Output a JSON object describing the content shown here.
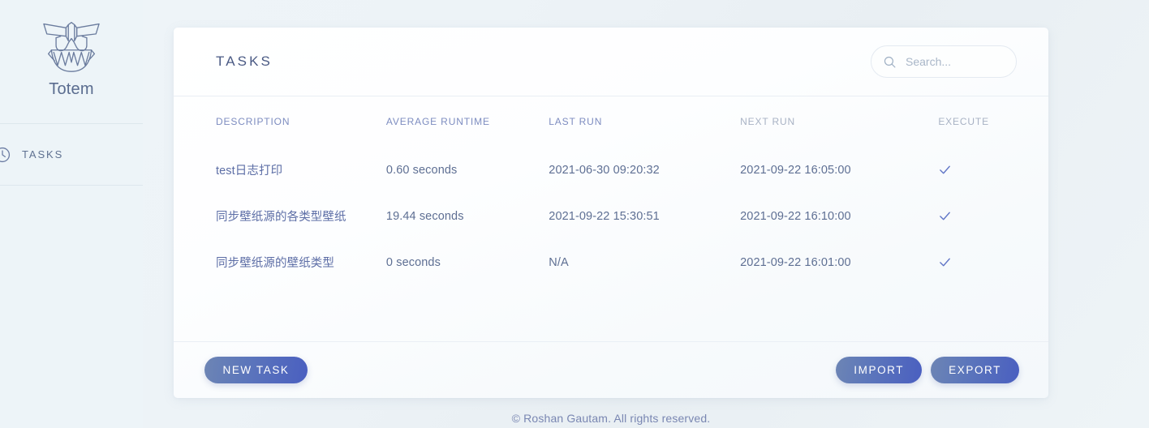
{
  "sidebar": {
    "brand": {
      "name": "Totem",
      "logo_icon": "totem-mask-icon"
    },
    "items": [
      {
        "label": "TASKS",
        "icon": "clock-icon",
        "active": true
      }
    ]
  },
  "header": {
    "title": "TASKS",
    "search": {
      "placeholder": "Search...",
      "value": "",
      "icon": "search-icon"
    }
  },
  "table": {
    "columns": [
      {
        "key": "description",
        "label": "DESCRIPTION",
        "muted": false
      },
      {
        "key": "average_runtime",
        "label": "AVERAGE RUNTIME",
        "muted": false
      },
      {
        "key": "last_run",
        "label": "LAST RUN",
        "muted": false
      },
      {
        "key": "next_run",
        "label": "NEXT RUN",
        "muted": true
      },
      {
        "key": "execute",
        "label": "EXECUTE",
        "muted": true
      }
    ],
    "rows": [
      {
        "description": "test日志打印",
        "average_runtime": "0.60 seconds",
        "last_run": "2021-06-30 09:20:32",
        "next_run": "2021-09-22 16:05:00",
        "execute_icon": "check-icon",
        "error": false
      },
      {
        "description": "同步壁纸源的各类型壁纸",
        "average_runtime": "19.44 seconds",
        "last_run": "2021-09-22 15:30:51",
        "next_run": "2021-09-22 16:10:00",
        "execute_icon": "check-icon",
        "error": false
      },
      {
        "description": "同步壁纸源的壁纸类型",
        "average_runtime": "0 seconds",
        "last_run": "N/A",
        "next_run": "2021-09-22 16:01:00",
        "execute_icon": "check-icon",
        "error": true
      }
    ]
  },
  "card_footer": {
    "new_task_label": "NEW TASK",
    "import_label": "IMPORT",
    "export_label": "EXPORT"
  },
  "page_footer": {
    "copyright": "© Roshan Gautam. All rights reserved."
  },
  "colors": {
    "page_background": "#eef4f8",
    "sidebar_background": "#edf4f8",
    "card_background": "#ffffff",
    "accent_blue": "#4a5fc0",
    "button_gradient_start": "#6d85b4",
    "button_gradient_end": "#4a5fc0",
    "header_text": "#4a5a84",
    "body_text": "#5e6f93",
    "column_header": "#7d8cc0",
    "column_header_muted": "#a8b2c4",
    "error_red": "#e0564a",
    "check_blue": "#5f74c6"
  }
}
